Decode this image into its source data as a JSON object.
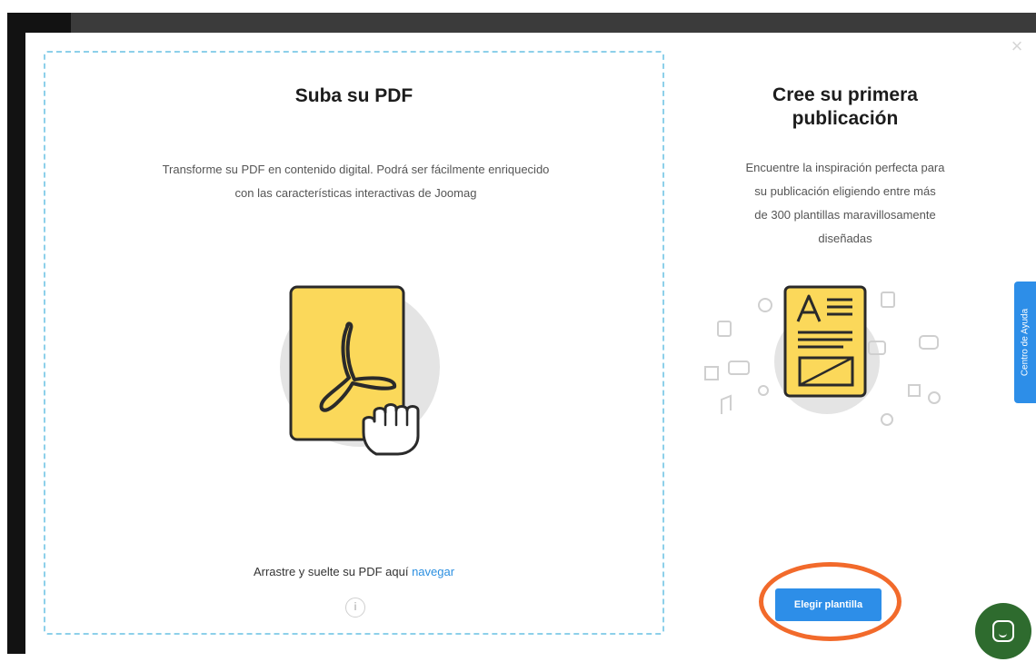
{
  "dialog": {
    "close_symbol": "×"
  },
  "upload": {
    "title": "Suba su PDF",
    "description_line1": "Transforme su PDF en contenido digital. Podrá ser fácilmente enriquecido",
    "description_line2": "con las características interactivas de Joomag",
    "drop_text": "Arrastre y suelte su PDF aquí",
    "browse_link": "navegar",
    "info_symbol": "i"
  },
  "create": {
    "title_line1": "Cree su primera",
    "title_line2": "publicación",
    "description_line1": "Encuentre la inspiración perfecta para",
    "description_line2": "su publicación eligiendo entre más",
    "description_line3": "de 300 plantillas maravillosamente",
    "description_line4": "diseñadas",
    "button_label": "Elegir plantilla"
  },
  "help_tab": {
    "label": "Centro de Ayuda"
  },
  "colors": {
    "accent_blue": "#2d8ee8",
    "highlight_orange": "#f26a2b",
    "pdf_yellow": "#fbd85a",
    "chat_green": "#2e6b2e",
    "dashed_border": "#8dd0ea"
  },
  "icons": {
    "pdf": "pdf-document-icon",
    "hand": "hand-grab-icon",
    "template": "template-document-icon",
    "info": "info-icon",
    "chat": "chat-icon",
    "close": "close-icon"
  }
}
